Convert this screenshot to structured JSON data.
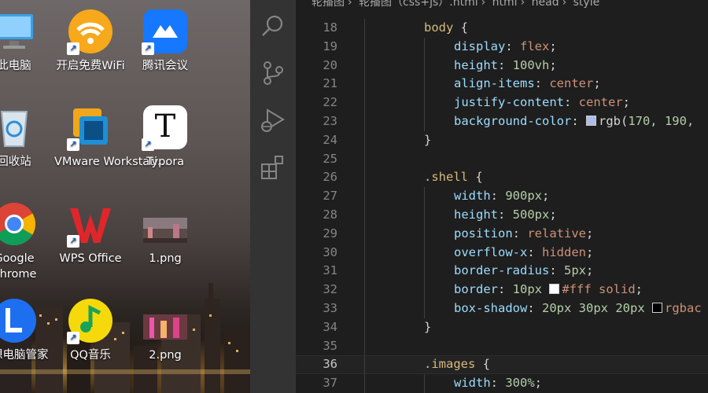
{
  "desktop": {
    "icons": [
      {
        "id": "this-pc",
        "label": "此电脑"
      },
      {
        "id": "wifi",
        "label": "开启免费WiFi"
      },
      {
        "id": "tencent-meeting",
        "label": "腾讯会议"
      },
      {
        "id": "recycle-bin",
        "label": "回收站"
      },
      {
        "id": "vmware",
        "label": "VMware Workstati..."
      },
      {
        "id": "typora",
        "label": "Typora"
      },
      {
        "id": "chrome",
        "label": "Google Chrome"
      },
      {
        "id": "wps",
        "label": "WPS Office"
      },
      {
        "id": "png1",
        "label": "1.png"
      },
      {
        "id": "pc-manager",
        "label": "联想电脑管家"
      },
      {
        "id": "qqmusic",
        "label": "QQ音乐"
      },
      {
        "id": "png2",
        "label": "2.png"
      }
    ],
    "typora_glyph": "T"
  },
  "activity_bar": {
    "icons": [
      "search-icon",
      "source-control-icon",
      "run-debug-icon",
      "extensions-icon"
    ]
  },
  "editor": {
    "breadcrumb": [
      "轮播图",
      "轮播图（css+js）.html",
      "html",
      "head",
      "style"
    ],
    "swatch_colors": {
      "body_bg": "#aabee6",
      "white": "#ffffff",
      "shadow": "#000000"
    },
    "current_line": 36,
    "lines": [
      {
        "n": "18",
        "sel": "body",
        "tail": " {"
      },
      {
        "n": "19",
        "prop": "display",
        "val": "flex"
      },
      {
        "n": "20",
        "prop": "height",
        "num": "100vh"
      },
      {
        "n": "21",
        "prop": "align-items",
        "val": "center"
      },
      {
        "n": "22",
        "prop": "justify-content",
        "val": "center"
      },
      {
        "n": "23",
        "prop": "background-color",
        "pre": "rgb(",
        "num": "170, 190,",
        "swatch": "body_bg",
        "noend": true
      },
      {
        "n": "24",
        "close": "}"
      },
      {
        "n": "25"
      },
      {
        "n": "26",
        "sel": ".shell",
        "tail": " {"
      },
      {
        "n": "27",
        "prop": "width",
        "num": "900px"
      },
      {
        "n": "28",
        "prop": "height",
        "num": "500px"
      },
      {
        "n": "29",
        "prop": "position",
        "val": "relative"
      },
      {
        "n": "30",
        "prop": "overflow-x",
        "val": "hidden"
      },
      {
        "n": "31",
        "prop": "border-radius",
        "num": "5px"
      },
      {
        "n": "32",
        "prop": "border",
        "num": "10px",
        "swatch": "white",
        "val2": "#fff solid"
      },
      {
        "n": "33",
        "prop": "box-shadow",
        "num": "20px 30px 20px",
        "swatch": "shadow",
        "val2": "rgbac",
        "noend": true
      },
      {
        "n": "34",
        "close": "}"
      },
      {
        "n": "35"
      },
      {
        "n": "36",
        "sel": ".images",
        "tail": " {"
      },
      {
        "n": "37",
        "prop": "width",
        "num": "300%"
      }
    ]
  }
}
